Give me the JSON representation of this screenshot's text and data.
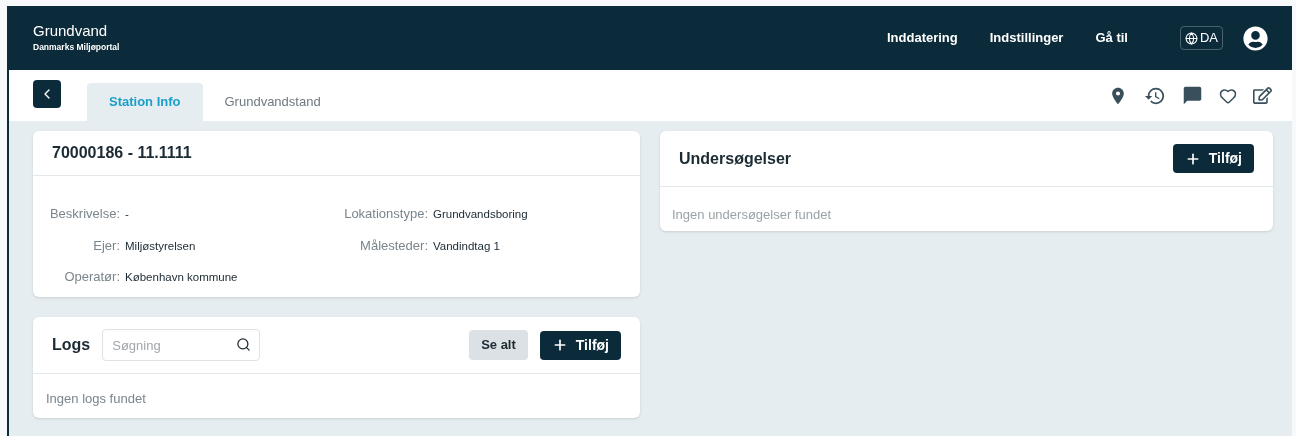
{
  "header": {
    "title": "Grundvand",
    "subtitle": "Danmarks Miljøportal",
    "nav": [
      "Inddatering",
      "Indstillinger",
      "Gå til"
    ],
    "language": "DA"
  },
  "tabs": [
    {
      "label": "Station Info",
      "selected": true
    },
    {
      "label": "Grundvandstand",
      "selected": false
    }
  ],
  "station": {
    "title": "70000186 - 11.1111",
    "fields_left": [
      {
        "label": "Beskrivelse:",
        "value": "-"
      },
      {
        "label": "Ejer:",
        "value": "Miljøstyrelsen"
      },
      {
        "label": "Operatør:",
        "value": "København kommune"
      }
    ],
    "fields_right": [
      {
        "label": "Lokationstype:",
        "value": "Grundvandsboring"
      },
      {
        "label": "Målesteder:",
        "value": "Vandindtag 1"
      }
    ]
  },
  "logs": {
    "title": "Logs",
    "search_placeholder": "Søgning",
    "see_all": "Se alt",
    "add": "Tilføj",
    "empty": "Ingen logs fundet"
  },
  "investigations": {
    "title": "Undersøgelser",
    "add": "Tilføj",
    "empty": "Ingen undersøgelser fundet"
  }
}
